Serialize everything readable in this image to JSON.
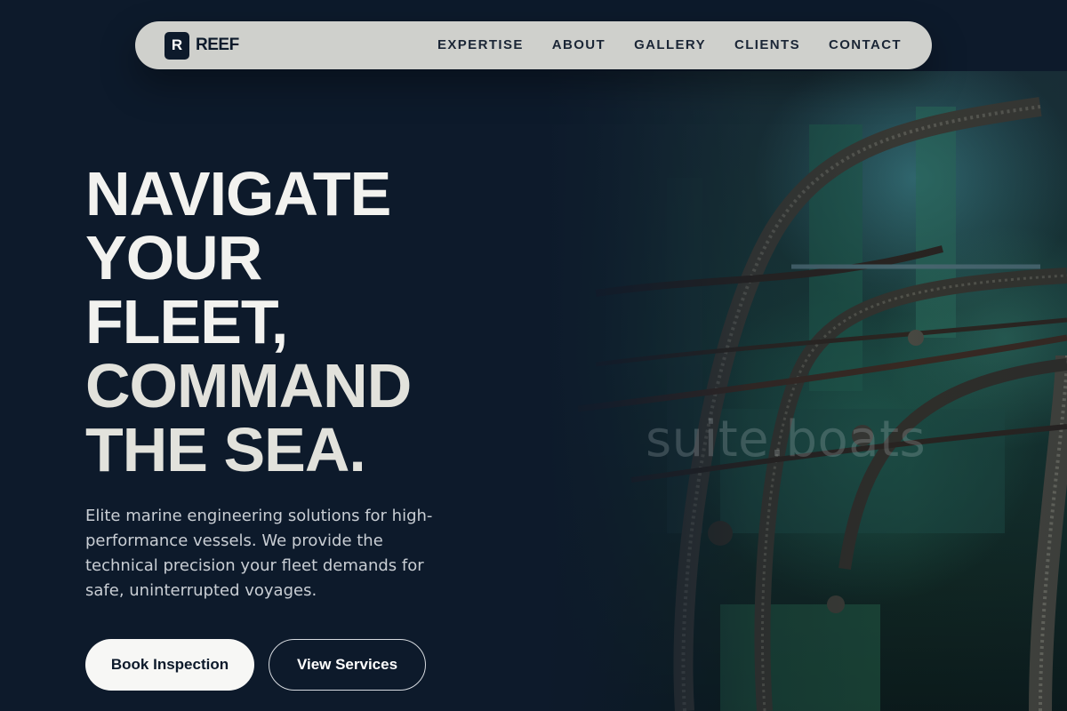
{
  "brand": {
    "mark": "R",
    "name": "REEF"
  },
  "nav": {
    "links": [
      "EXPERTISE",
      "ABOUT",
      "GALLERY",
      "CLIENTS",
      "CONTACT"
    ]
  },
  "hero": {
    "title_lines": [
      "NAVIGATE",
      "YOUR",
      "FLEET,",
      "COMMAND",
      "THE SEA."
    ],
    "subtitle": "Elite marine engineering solutions for high-performance vessels. We provide the technical precision your fleet demands for safe, uninterrupted voyages.",
    "primary_cta": "Book Inspection",
    "secondary_cta": "View Services",
    "image_watermark": "suite.boats"
  },
  "colors": {
    "background": "#0d1a2b",
    "navbar": "#cfd0cc",
    "text_light": "#f2f2ef",
    "button_light": "#f7f7f5"
  }
}
